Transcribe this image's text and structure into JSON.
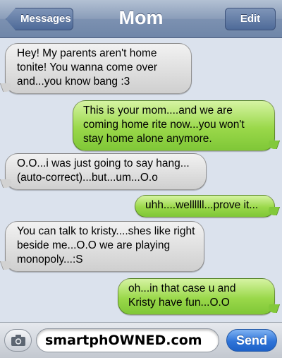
{
  "header": {
    "back_label": "Messages",
    "title": "Mom",
    "edit_label": "Edit"
  },
  "messages": [
    {
      "direction": "incoming",
      "text": "Hey! My parents aren't home tonite! You wanna come over and...you know bang :3"
    },
    {
      "direction": "outgoing",
      "text": "This is your mom....and we are coming home rite now...you won't stay home alone anymore."
    },
    {
      "direction": "incoming",
      "text": "O.O...i was just going to say hang...(auto-correct)...but...um...O.o"
    },
    {
      "direction": "outgoing",
      "text": "uhh....wellllll...prove it..."
    },
    {
      "direction": "incoming",
      "text": "You can talk to kristy....shes like right beside me...O.O we are playing monopoly...:S"
    },
    {
      "direction": "outgoing",
      "text": "oh...in that case u and Kristy have fun...O.O"
    }
  ],
  "composer": {
    "input_value": "smartphOWNED.com",
    "send_label": "Send",
    "camera_icon": "camera-icon"
  },
  "colors": {
    "incoming_bubble": "#dedede",
    "outgoing_bubble": "#98d64a",
    "background": "#dbe2ed",
    "send_button": "#2f74d8"
  }
}
